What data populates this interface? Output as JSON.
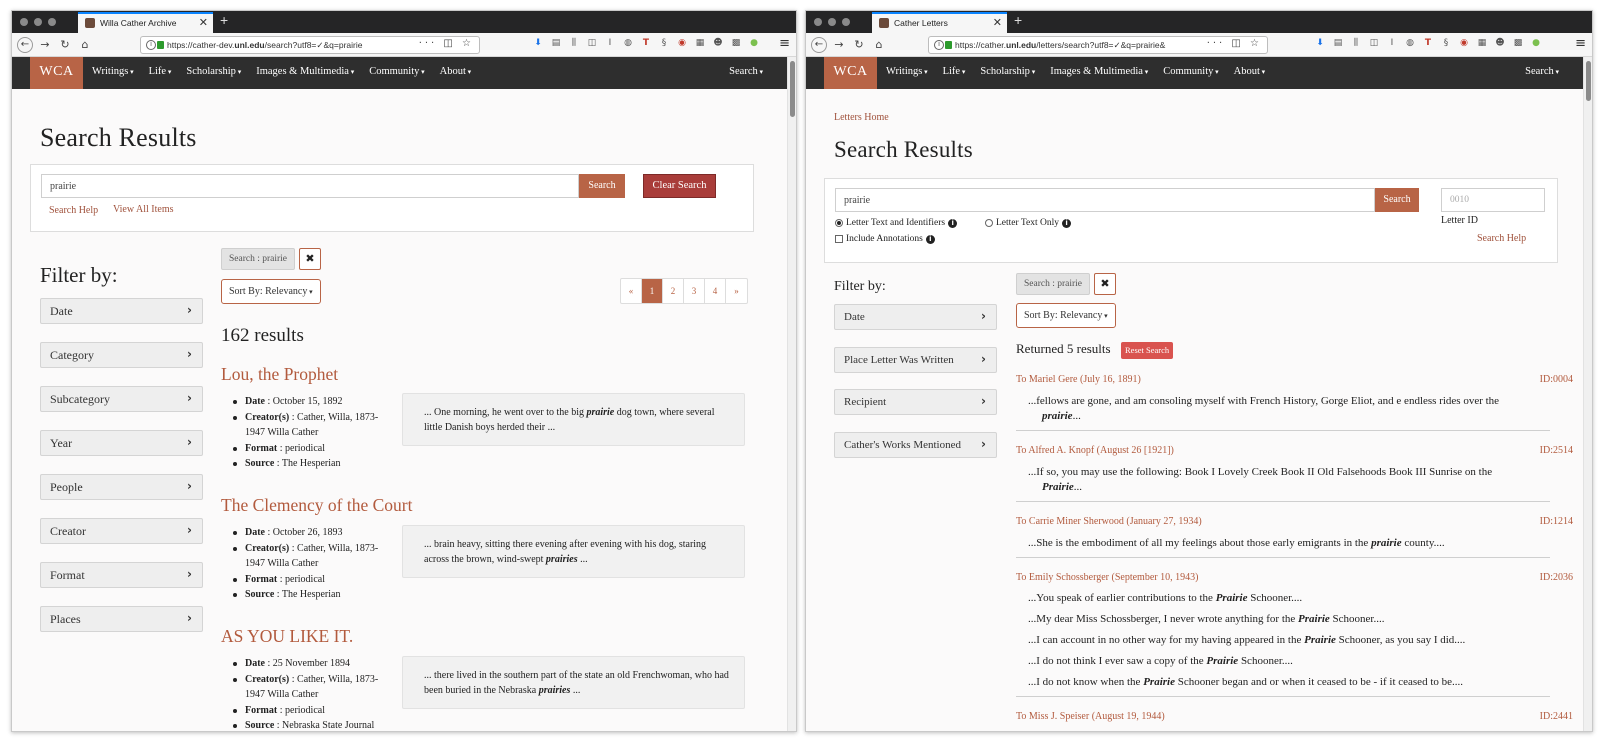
{
  "left_window": {
    "tab_title": "Willa Cather Archive",
    "url_prefix": "https://cather-dev.",
    "url_domain": "unl.edu",
    "url_suffix": "/search?utf8=✓&q=prairie",
    "site": {
      "logo": "WCA",
      "menu": [
        "Writings",
        "Life",
        "Scholarship",
        "Images & Multimedia",
        "Community",
        "About"
      ],
      "search": "Search"
    },
    "page_title": "Search Results",
    "search_value": "prairie",
    "search_button": "Search",
    "clear_button": "Clear Search",
    "search_help": "Search Help",
    "view_all": "View All Items",
    "filter_title": "Filter by:",
    "filters": [
      "Date",
      "Category",
      "Subcategory",
      "Year",
      "People",
      "Creator",
      "Format",
      "Places"
    ],
    "active_filter": "Search : prairie",
    "remove_filter": "✖",
    "sort": "Sort By: Relevancy",
    "pagination": [
      "«",
      "1",
      "2",
      "3",
      "4",
      "»"
    ],
    "result_count": "162 results",
    "results": [
      {
        "title": "Lou, the Prophet",
        "date_label": "Date",
        "date": "October 15, 1892",
        "creator_label": "Creator(s)",
        "creator": "Cather, Willa, 1873-1947 Willa Cather",
        "format_label": "Format",
        "format": "periodical",
        "source_label": "Source",
        "source": "The Hesperian",
        "snippet_before": "... One morning, he went over to the big ",
        "snippet_hit": "prairie",
        "snippet_after": " dog town, where several little Danish boys herded their ..."
      },
      {
        "title": "The Clemency of the Court",
        "date_label": "Date",
        "date": "October 26, 1893",
        "creator_label": "Creator(s)",
        "creator": "Cather, Willa, 1873-1947 Willa Cather",
        "format_label": "Format",
        "format": "periodical",
        "source_label": "Source",
        "source": "The Hesperian",
        "snippet_before": "... brain heavy, sitting there evening after evening with his dog, staring across the brown, wind-swept ",
        "snippet_hit": "prairies",
        "snippet_after": " ..."
      },
      {
        "title": "AS YOU LIKE IT.",
        "date_label": "Date",
        "date": "25 November 1894",
        "creator_label": "Creator(s)",
        "creator": "Cather, Willa, 1873-1947 Willa Cather",
        "format_label": "Format",
        "format": "periodical",
        "source_label": "Source",
        "source": "Nebraska State Journal",
        "snippet_before": "... there lived in the southern part of the state an old Frenchwoman, who had been buried in the Nebraska ",
        "snippet_hit": "prairies",
        "snippet_after": " ..."
      }
    ]
  },
  "right_window": {
    "tab_title": "Cather Letters",
    "url_prefix": "https://cather.",
    "url_domain": "unl.edu",
    "url_suffix": "/letters/search?utf8=✓&q=prairie&",
    "site": {
      "logo": "WCA",
      "menu": [
        "Writings",
        "Life",
        "Scholarship",
        "Images & Multimedia",
        "Community",
        "About"
      ],
      "search": "Search"
    },
    "breadcrumb": "Letters Home",
    "page_title": "Search Results",
    "search_value": "prairie",
    "search_button": "Search",
    "option_text_identifiers": "Letter Text and Identifiers",
    "option_text_only": "Letter Text Only",
    "option_annotations": "Include Annotations",
    "letter_id_placeholder": "0010",
    "letter_id_label": "Letter ID",
    "search_help": "Search Help",
    "filter_title": "Filter by:",
    "filters": [
      "Date",
      "Place Letter Was Written",
      "Recipient",
      "Cather's Works Mentioned"
    ],
    "active_filter": "Search : prairie",
    "remove_filter": "✖",
    "sort": "Sort By: Relevancy",
    "returned": "Returned 5 results",
    "reset": "Reset Search",
    "letters": [
      {
        "title": "To Mariel Gere (July 16, 1891)",
        "id": "ID:0004",
        "lines": [
          {
            "before": "...fellows are gone, and am consoling myself with French History, Gorge Eliot, and e endless rides over the",
            "hit": "",
            "after": ""
          },
          {
            "before": "",
            "hit": "prairie",
            "after": "..."
          }
        ]
      },
      {
        "title": "To Alfred A. Knopf (August 26 [1921])",
        "id": "ID:2514",
        "lines": [
          {
            "before": "...If so, you may use the following: Book I Lovely Creek Book II Old Falsehoods Book III Sunrise on the",
            "hit": "",
            "after": ""
          },
          {
            "before": "",
            "hit": "Prairie",
            "after": "..."
          }
        ]
      },
      {
        "title": "To Carrie Miner Sherwood (January 27, 1934)",
        "id": "ID:1214",
        "lines": [
          {
            "before": "...She is the embodiment of all my feelings about those early emigrants in the ",
            "hit": "prairie",
            "after": " county...."
          }
        ]
      },
      {
        "title": "To Emily Schossberger (September 10, 1943)",
        "id": "ID:2036",
        "lines": [
          {
            "before": "...You speak of earlier contributions to the ",
            "hit": "Prairie",
            "after": " Schooner...."
          },
          {
            "before": "...My dear Miss Schossberger, I never wrote anything for the ",
            "hit": "Prairie",
            "after": " Schooner...."
          },
          {
            "before": "...I can account in no other way for my having appeared in the ",
            "hit": "Prairie",
            "after": " Schooner, as you say I did...."
          },
          {
            "before": "...I do not think I ever saw a copy of the ",
            "hit": "Prairie",
            "after": " Schooner...."
          },
          {
            "before": "...I do not know when the ",
            "hit": "Prairie",
            "after": " Schooner began and or when it ceased to be - if it ceased to be...."
          }
        ]
      },
      {
        "title": "To Miss J. Speiser (August 19, 1944)",
        "id": "ID:2441",
        "lines": []
      }
    ]
  }
}
